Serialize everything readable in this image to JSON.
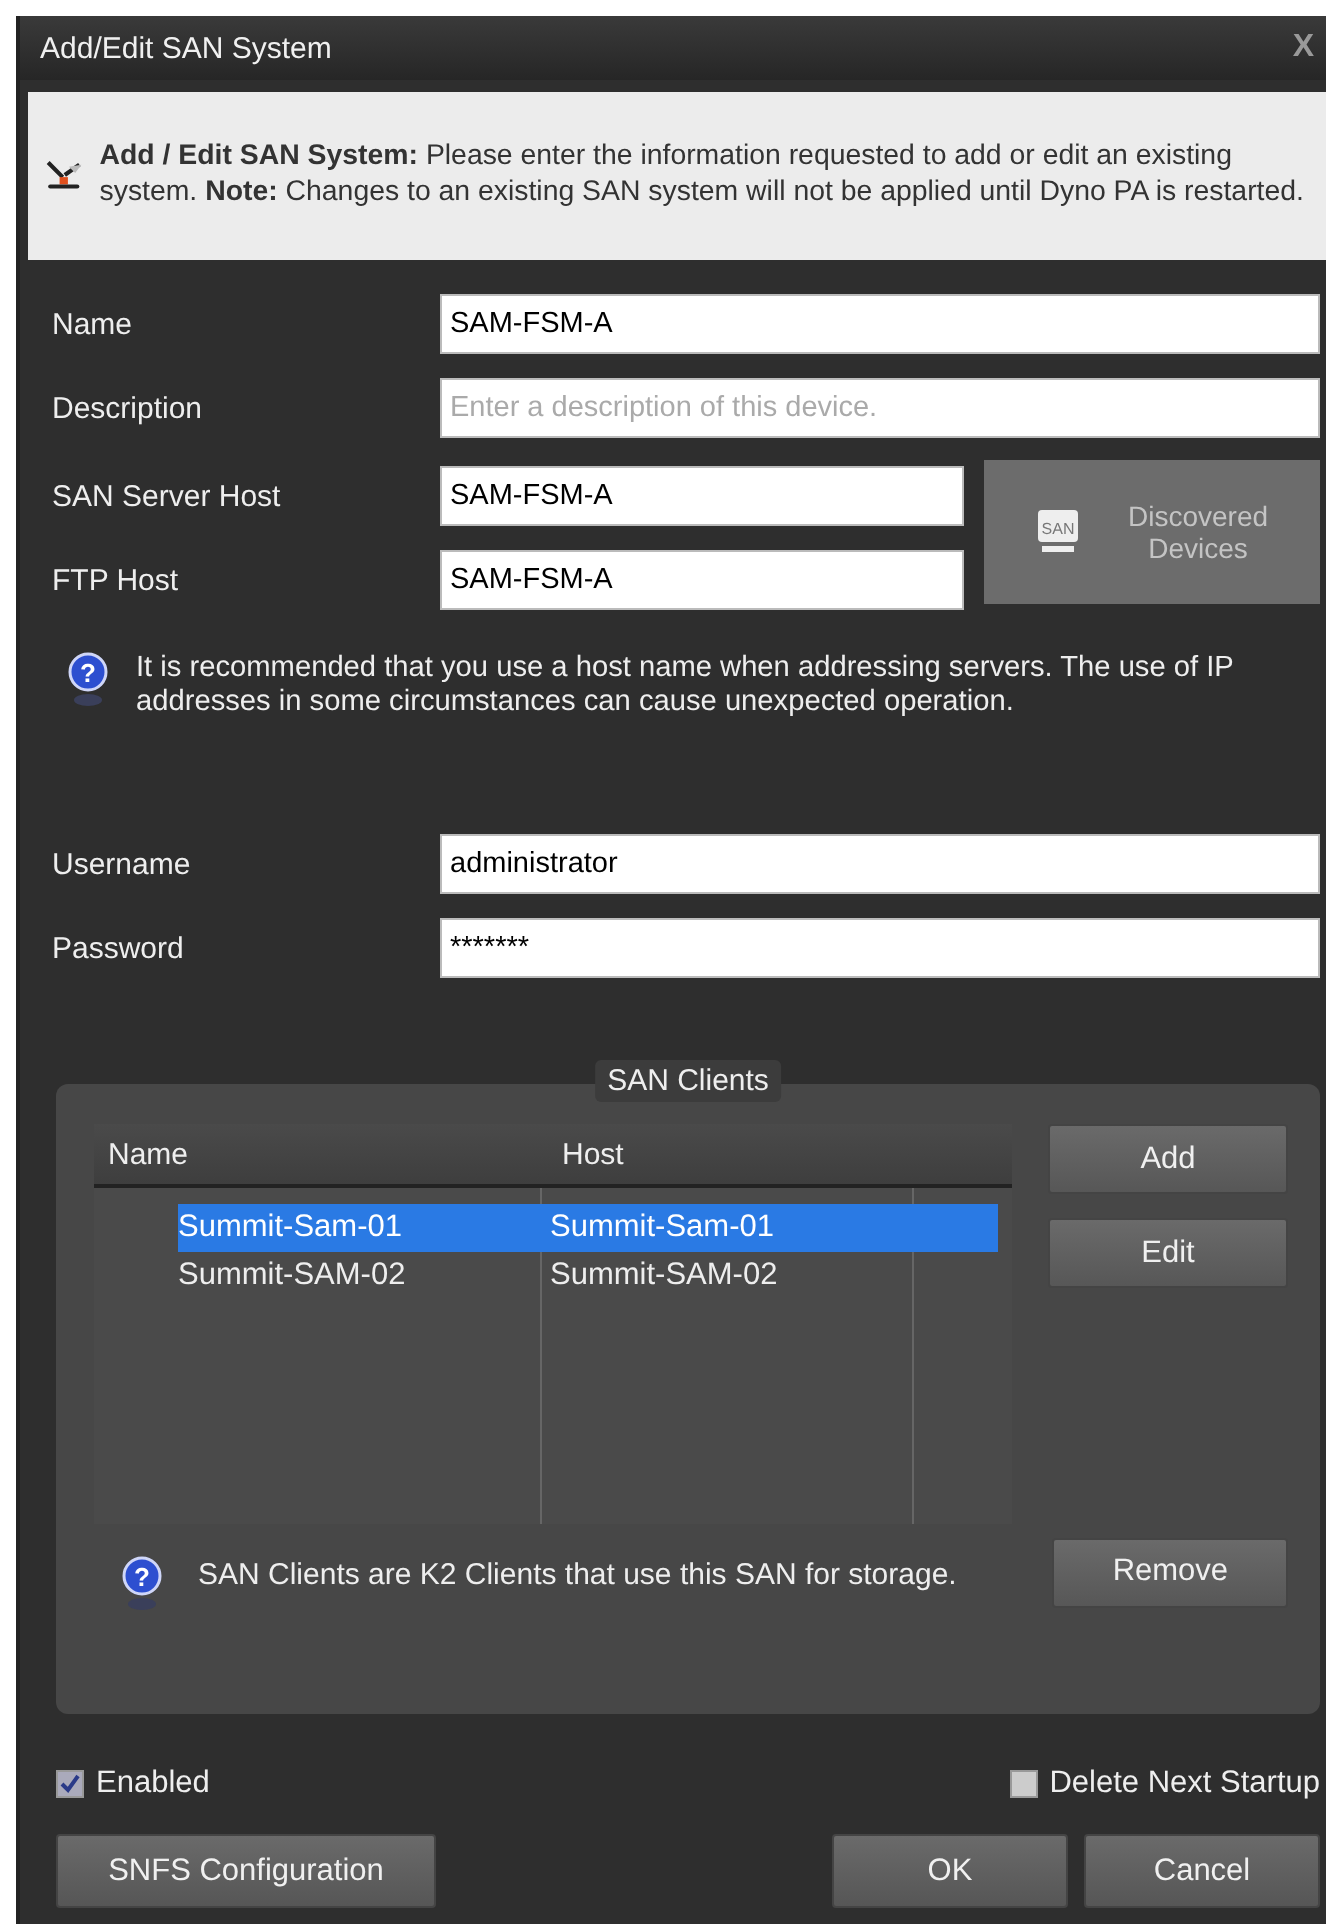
{
  "window": {
    "title": "Add/Edit SAN System",
    "close": "X"
  },
  "banner": {
    "text": "**Add / Edit SAN System:** Please enter the information requested to add or edit an existing system. **Note:** Changes to an existing SAN system will not be applied until Dyno PA is restarted."
  },
  "fields": [
    {
      "label": "Name",
      "value": "SAM-FSM-A"
    },
    {
      "label": "Description",
      "placeholder": "Enter a description of this device."
    }
  ],
  "host_fields": [
    {
      "label": "SAN Server Host",
      "value": "SAM-FSM-A"
    },
    {
      "label": "FTP Host",
      "value": "SAM-FSM-A"
    }
  ],
  "discover_button": {
    "icon_text": "SAN",
    "label": "Discovered Devices",
    "disabled": true
  },
  "host_info_icon": "?",
  "host_info": "It is recommended that you use a host name when addressing servers. The use of IP addresses in some circumstances can cause unexpected operation.",
  "credentials": [
    {
      "label": "Username",
      "value": "administrator"
    },
    {
      "label": "Password",
      "value": "*******"
    }
  ],
  "san_clients": {
    "title": "SAN Clients",
    "columns": [
      "Name",
      "Host"
    ],
    "rows": [
      {
        "name": "Summit-Sam-01",
        "host": "Summit-Sam-01",
        "selected": true
      },
      {
        "name": "Summit-SAM-02",
        "host": "Summit-SAM-02",
        "selected": false
      }
    ],
    "buttons": [
      "Add",
      "Edit",
      "Remove"
    ],
    "info_icon": "?",
    "info": "SAN Clients are K2 Clients that use this SAN for storage."
  },
  "options": [
    {
      "label": "Enabled",
      "checked": true
    },
    {
      "label": "Delete Next Startup",
      "checked": false
    }
  ],
  "buttons": [
    "SNFS Configuration",
    "OK",
    "Cancel"
  ]
}
